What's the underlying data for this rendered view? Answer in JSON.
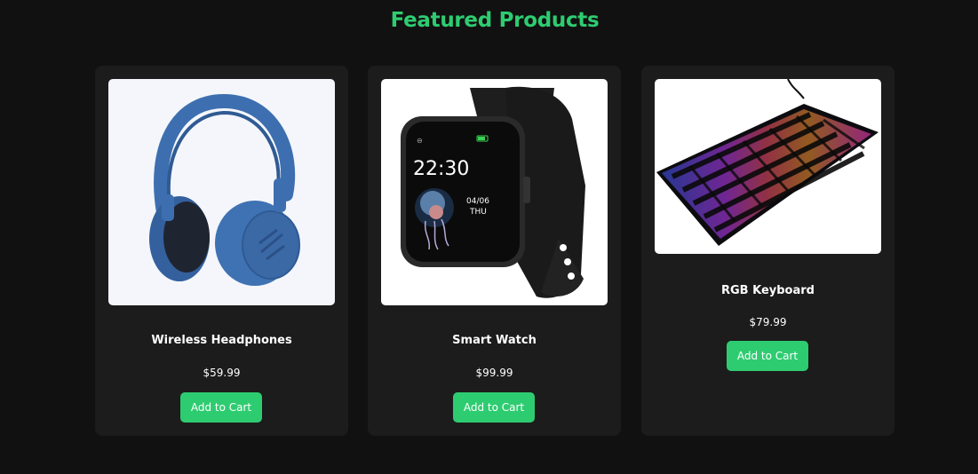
{
  "page": {
    "title": "Featured Products",
    "accent_color": "#2ecc71",
    "background_color": "#111111",
    "card_color": "#1c1c1c"
  },
  "products": [
    {
      "name": "Wireless Headphones",
      "price": "$59.99",
      "button_label": "Add to Cart",
      "image": "headphones-image"
    },
    {
      "name": "Smart Watch",
      "price": "$99.99",
      "button_label": "Add to Cart",
      "image": "smartwatch-image",
      "watch_time": "22:30",
      "watch_date": "04/06",
      "watch_day": "THU"
    },
    {
      "name": "RGB Keyboard",
      "price": "$79.99",
      "button_label": "Add to Cart",
      "image": "rgb-keyboard-image"
    }
  ]
}
